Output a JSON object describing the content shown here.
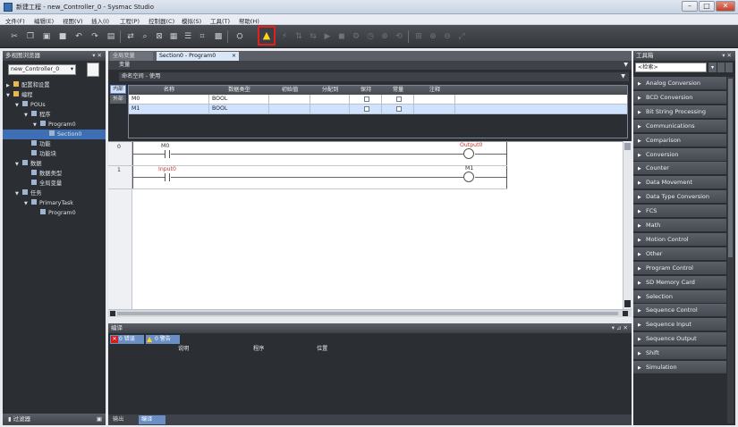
{
  "window": {
    "title": "新建工程 - new_Controller_0 - Sysmac Studio",
    "min": "–",
    "max": "□",
    "close": "✕"
  },
  "menu": [
    "文件(F)",
    "编辑(E)",
    "视图(V)",
    "插入(I)",
    "工程(P)",
    "控制器(C)",
    "模拟(S)",
    "工具(T)",
    "帮助(H)"
  ],
  "left_panel": {
    "title": "多视图浏览器",
    "controller": "new_Controller_0",
    "tree": [
      {
        "label": "配置和设置",
        "indent": 0,
        "expander": "▶"
      },
      {
        "label": "编程",
        "indent": 0,
        "expander": "▼"
      },
      {
        "label": "POUs",
        "indent": 1,
        "expander": "▼"
      },
      {
        "label": "程序",
        "indent": 2,
        "expander": "▼"
      },
      {
        "label": "Program0",
        "indent": 3,
        "expander": "▼"
      },
      {
        "label": "Section0",
        "indent": 4,
        "expander": ""
      },
      {
        "label": "功能",
        "indent": 2,
        "expander": ""
      },
      {
        "label": "功能块",
        "indent": 2,
        "expander": ""
      },
      {
        "label": "数据",
        "indent": 1,
        "expander": "▼"
      },
      {
        "label": "数据类型",
        "indent": 2,
        "expander": ""
      },
      {
        "label": "全局变量",
        "indent": 2,
        "expander": ""
      },
      {
        "label": "任务",
        "indent": 1,
        "expander": "▼"
      },
      {
        "label": "PrimaryTask",
        "indent": 2,
        "expander": "▼"
      },
      {
        "label": "Program0",
        "indent": 3,
        "expander": ""
      }
    ],
    "footer": "过滤器"
  },
  "tabs": [
    {
      "label": "全局变量",
      "active": false
    },
    {
      "label": "Section0 - Program0",
      "active": true,
      "close": "×"
    }
  ],
  "vars": {
    "header": "变量",
    "namespace": "命名空间 - 使用",
    "side_tabs": [
      "内部",
      "外部"
    ],
    "columns": [
      "名称",
      "数据类型",
      "初始值",
      "分配到",
      "保持",
      "常量",
      "注释"
    ],
    "rows": [
      {
        "name": "M0",
        "type": "BOOL"
      },
      {
        "name": "M1",
        "type": "BOOL"
      }
    ]
  },
  "ladder": {
    "rungs": [
      {
        "num": "0",
        "contact": "M0",
        "coil": "Output0"
      },
      {
        "num": "1",
        "contact": "Input0",
        "coil": "M1"
      }
    ]
  },
  "bottom_panel": {
    "title": "编译",
    "btn_errors": "0 错误",
    "btn_warnings": "0 警告",
    "columns": [
      "说明",
      "程序",
      "位置"
    ],
    "footer_tabs": [
      "输出",
      "编译"
    ]
  },
  "toolbox": {
    "title": "工具箱",
    "search": "<检索>",
    "items": [
      "Analog Conversion",
      "BCD Conversion",
      "Bit String Processing",
      "Communications",
      "Comparison",
      "Conversion",
      "Counter",
      "Data Movement",
      "Data Type Conversion",
      "FCS",
      "Math",
      "Motion Control",
      "Other",
      "Program Control",
      "SD Memory Card",
      "Selection",
      "Sequence Control",
      "Sequence Input",
      "Sequence Output",
      "Shift",
      "Simulation"
    ]
  },
  "colors": {
    "warning": "#ffd21c",
    "highlight": "#e0201c",
    "selected_row": "#cfe3ff",
    "coil_label": "#c0392b"
  },
  "icons": [
    "cut-icon",
    "copy-icon",
    "paste-icon",
    "delete-icon",
    "undo-icon",
    "redo-icon",
    "save-icon",
    "warning-icon"
  ]
}
